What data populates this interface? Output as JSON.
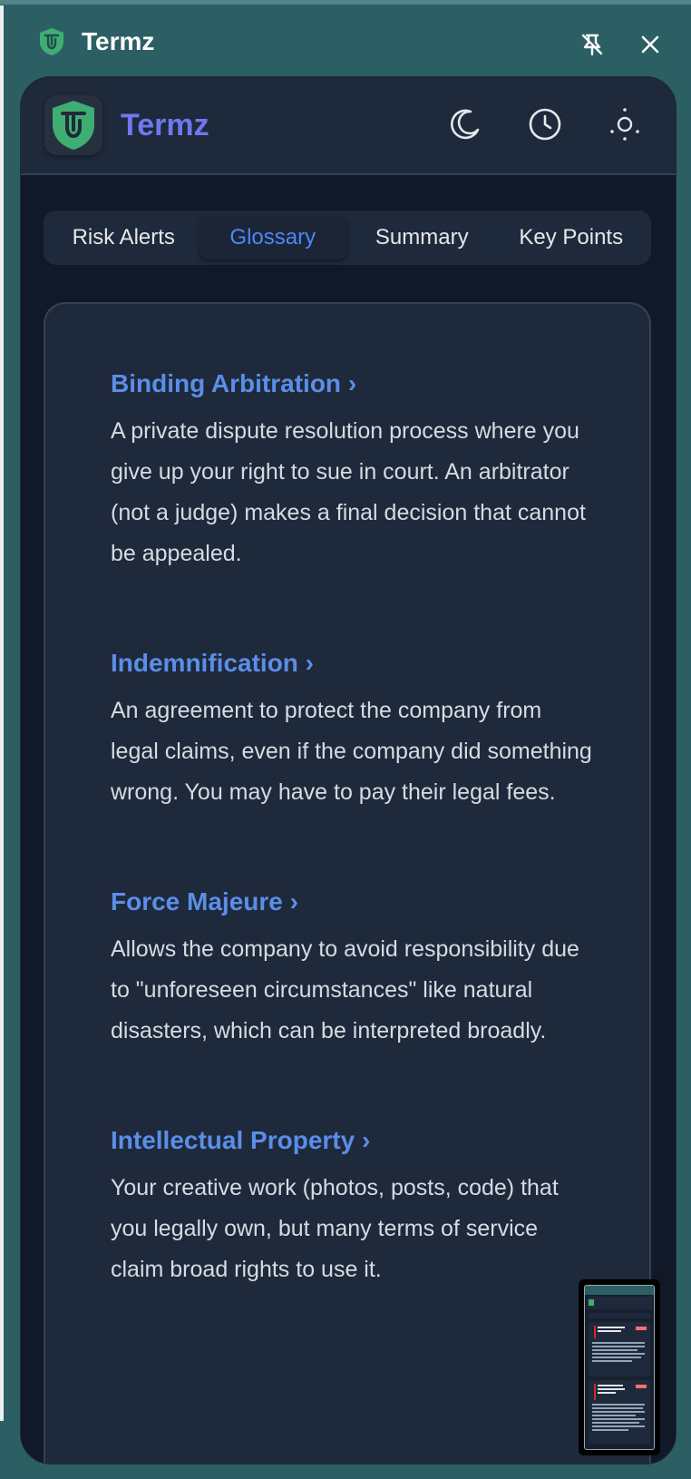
{
  "window": {
    "title": "Termz"
  },
  "app": {
    "title": "Termz"
  },
  "tabs": [
    {
      "label": "Risk Alerts",
      "active": false
    },
    {
      "label": "Glossary",
      "active": true
    },
    {
      "label": "Summary",
      "active": false
    },
    {
      "label": "Key Points",
      "active": false
    }
  ],
  "glossary": [
    {
      "term": "Binding Arbitration ›",
      "definition": "A private dispute resolution process where you give up your right to sue in court. An arbitrator (not a judge) makes a final decision that cannot be appealed."
    },
    {
      "term": "Indemnification ›",
      "definition": "An agreement to protect the company from legal claims, even if the company did something wrong. You may have to pay their legal fees."
    },
    {
      "term": "Force Majeure ›",
      "definition": "Allows the company to avoid responsibility due to \"unforeseen circumstances\" like natural disasters, which can be interpreted broadly."
    },
    {
      "term": "Intellectual Property ›",
      "definition": "Your creative work (photos, posts, code) that you legally own, but many terms of service claim broad rights to use it."
    }
  ],
  "icons": {
    "titlebar": [
      "shield-logo-icon",
      "unpin-icon",
      "close-icon"
    ],
    "header": [
      "moon-icon",
      "history-clock-icon",
      "settings-sun-icon"
    ]
  },
  "colors": {
    "window_bg": "#2c5f63",
    "panel_bg": "#111827",
    "card_bg": "#1e293b",
    "accent_brand": "#6f78f0",
    "link_blue": "#5b8ee8",
    "logo_green": "#3fae72"
  }
}
